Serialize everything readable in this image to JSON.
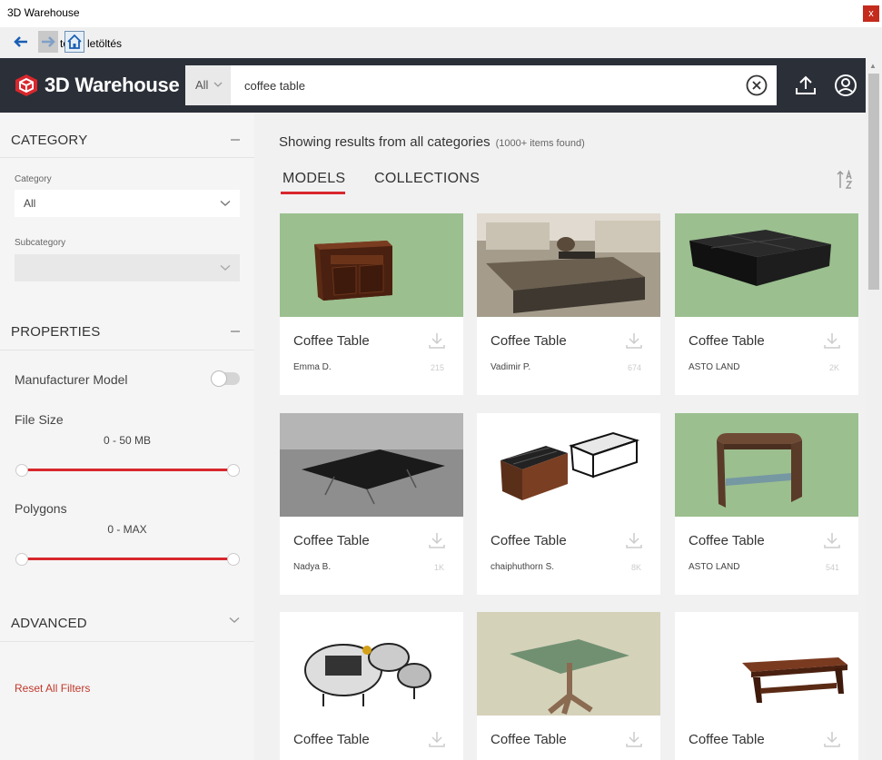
{
  "window": {
    "title": "3D Warehouse",
    "close_label": "x"
  },
  "navbar": {
    "title": "törös letöltés"
  },
  "header": {
    "logo_text": "3D Warehouse",
    "search_scope": "All",
    "search_value": "coffee table"
  },
  "sidebar": {
    "category": {
      "heading": "CATEGORY",
      "category_label": "Category",
      "category_value": "All",
      "subcategory_label": "Subcategory",
      "subcategory_value": ""
    },
    "properties": {
      "heading": "PROPERTIES",
      "manufacturer_label": "Manufacturer Model",
      "manufacturer_on": false,
      "file_size_label": "File Size",
      "file_size_value": "0 - 50 MB",
      "polygons_label": "Polygons",
      "polygons_value": "0 - MAX"
    },
    "advanced": {
      "heading": "ADVANCED"
    },
    "reset_label": "Reset All Filters"
  },
  "main": {
    "results_text": "Showing results from all categories",
    "results_count": "(1000+ items found)",
    "tabs": [
      {
        "label": "MODELS",
        "active": true
      },
      {
        "label": "COLLECTIONS",
        "active": false
      }
    ],
    "cards": [
      {
        "name": "Coffee Table",
        "author": "Emma D.",
        "count": "215",
        "thumb": "cabinet",
        "bg": "#9bbf8f"
      },
      {
        "name": "Coffee Table",
        "author": "Vadimir P.",
        "count": "674",
        "thumb": "photo-living",
        "bg": "#bfb9ae"
      },
      {
        "name": "Coffee Table",
        "author": "ASTO LAND",
        "count": "2K",
        "thumb": "black-square",
        "bg": "#9bbf8f"
      },
      {
        "name": "Coffee Table",
        "author": "Nadya B.",
        "count": "1K",
        "thumb": "glass-floor",
        "bg": "#8d8d8d"
      },
      {
        "name": "Coffee Table",
        "author": "chaiphuthorn S.",
        "count": "8K",
        "thumb": "two-boxes",
        "bg": "#ffffff"
      },
      {
        "name": "Coffee Table",
        "author": "ASTO LAND",
        "count": "541",
        "thumb": "wood-glass",
        "bg": "#9bbf8f"
      },
      {
        "name": "Coffee Table",
        "author": "",
        "count": "",
        "thumb": "round-tables",
        "bg": "#ffffff"
      },
      {
        "name": "Coffee Table",
        "author": "",
        "count": "",
        "thumb": "glass-square",
        "bg": "#d5d2ba"
      },
      {
        "name": "Coffee Table",
        "author": "",
        "count": "",
        "thumb": "wood-bench",
        "bg": "#ffffff"
      }
    ]
  },
  "colors": {
    "accent": "#d8272d",
    "header": "#2b2f38",
    "green_bg": "#9bbf8f"
  }
}
